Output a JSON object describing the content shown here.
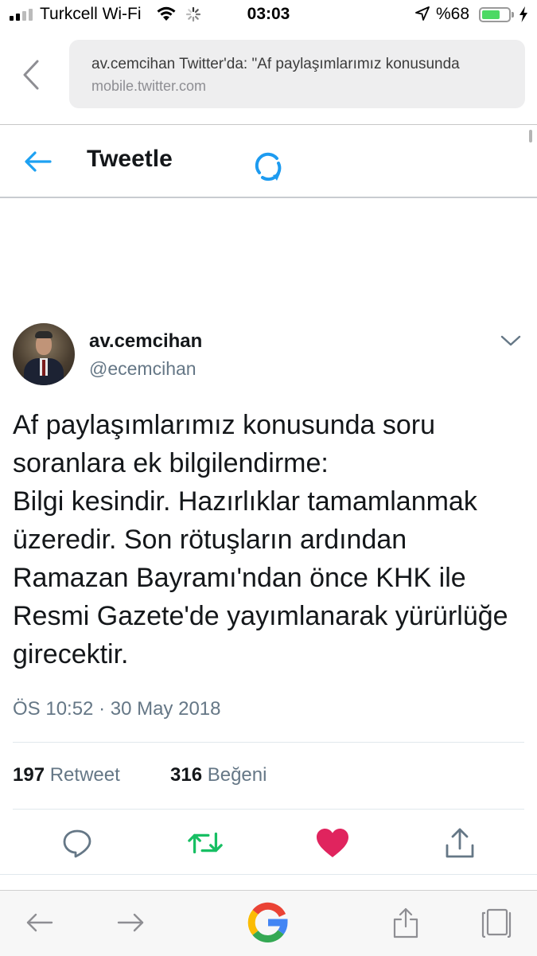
{
  "status_bar": {
    "carrier": "Turkcell Wi-Fi",
    "time": "03:03",
    "battery_percent": "%68",
    "battery_level": 0.68,
    "icons": [
      "signal-icon",
      "wifi-icon",
      "activity-spinner-icon",
      "location-arrow-icon",
      "battery-icon",
      "charging-bolt-icon"
    ]
  },
  "browser": {
    "page_title": "av.cemcihan Twitter'da: \"Af paylaşımlarımız konusunda",
    "domain": "mobile.twitter.com",
    "icons": [
      "back-chevron-icon"
    ]
  },
  "twitter_header": {
    "title": "Tweetle",
    "icons": [
      "back-arrow-icon",
      "refresh-spinner-icon"
    ]
  },
  "tweet": {
    "author_name": "av.cemcihan",
    "author_handle": "@ecemcihan",
    "text": "Af paylaşımlarımız konusunda soru soranlara ek bilgilendirme:\nBilgi kesindir. Hazırlıklar tamamlanmak üzeredir. Son rötuşların ardından Ramazan Bayramı'ndan önce KHK ile Resmi Gazete'de yayımlanarak yürürlüğe girecektir.",
    "timestamp": "ÖS 10:52 · 30 May 2018",
    "retweet_count": "197",
    "retweet_label": "Retweet",
    "like_count": "316",
    "like_label": "Beğeni",
    "actions": [
      "reply-icon",
      "retweet-icon",
      "like-heart-icon",
      "share-icon"
    ],
    "colors": {
      "retweet_green": "#17bf63",
      "like_red": "#e0245e",
      "twitter_blue": "#1da1f2"
    }
  },
  "browser_toolbar": {
    "items": [
      "back-arrow-icon",
      "forward-arrow-icon",
      "google-logo",
      "share-icon",
      "tabs-icon"
    ]
  }
}
